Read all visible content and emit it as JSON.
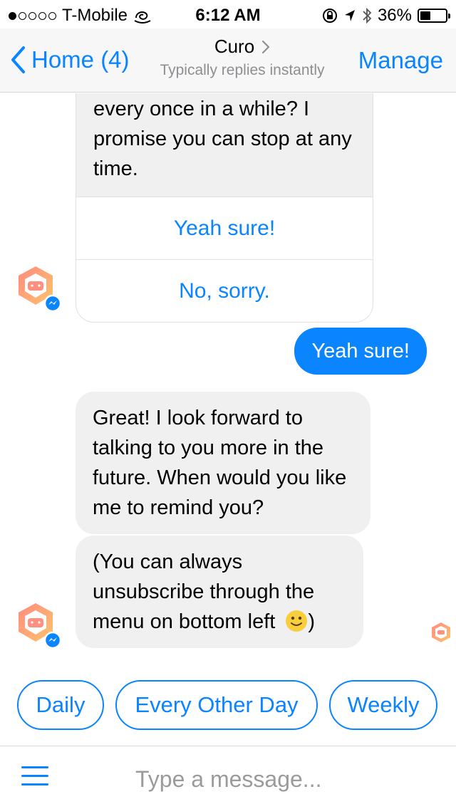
{
  "status_bar": {
    "carrier": "T-Mobile",
    "time": "6:12 AM",
    "battery": "36%",
    "battery_level": 0.36
  },
  "nav": {
    "back_label": "Home (4)",
    "title": "Curo",
    "subtitle": "Typically replies instantly",
    "manage_label": "Manage"
  },
  "messages": {
    "card_text": "every once in a while? I promise you can stop at any time.",
    "card_options": [
      "Yeah sure!",
      "No, sorry."
    ],
    "user_reply": "Yeah sure!",
    "bot_message_1": "Great! I look forward to talking to you more in the future. When would you like me to remind you?",
    "bot_message_2": "(You can always unsubscribe through the menu on bottom left",
    "bot_message_2_end": ")"
  },
  "quick_replies": [
    "Daily",
    "Every Other Day",
    "Weekly"
  ],
  "composer": {
    "placeholder": "Type a message..."
  },
  "colors": {
    "accent": "#0a84ff",
    "incoming_bubble": "#f0f0f0",
    "avatar_gradient_start": "#ff8a80",
    "avatar_gradient_end": "#ffc46b"
  }
}
